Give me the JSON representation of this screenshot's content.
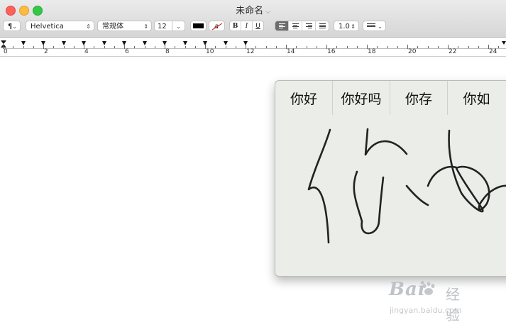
{
  "window": {
    "title": "未命名"
  },
  "toolbar": {
    "paragraph_style_label": "¶",
    "font_family": "Helvetica",
    "typeface": "常规体",
    "font_size": "12",
    "text_color": "#000000",
    "highlight_label": "a",
    "bold_label": "B",
    "italic_label": "I",
    "underline_label": "U",
    "line_spacing": "1.0",
    "alignment_selected": "left"
  },
  "ruler": {
    "numbers": [
      "0",
      "2",
      "4",
      "6",
      "8",
      "10",
      "12",
      "14",
      "16",
      "18",
      "20",
      "22",
      "24"
    ]
  },
  "handwriting": {
    "candidates": [
      "你好",
      "你好吗",
      "你存",
      "你如"
    ],
    "ink_color": "#222222"
  },
  "watermark": {
    "brand": "Bai",
    "brand_cn": "经验",
    "url": "jingyan.baidu.com"
  }
}
